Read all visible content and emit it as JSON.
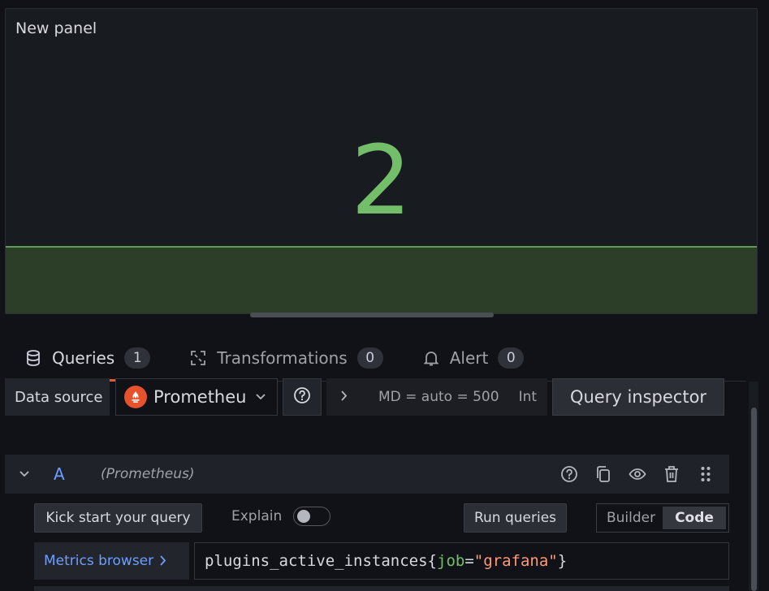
{
  "panel": {
    "title": "New panel",
    "stat_value": "2",
    "value_color": "#73bf69"
  },
  "tabs": [
    {
      "label": "Queries",
      "count": "1",
      "icon": "database-icon",
      "active": true
    },
    {
      "label": "Transformations",
      "count": "0",
      "icon": "transform-icon",
      "active": false
    },
    {
      "label": "Alert",
      "count": "0",
      "icon": "bell-icon",
      "active": false
    }
  ],
  "toolbar": {
    "datasource_label": "Data source",
    "datasource_name": "Prometheu",
    "options_text": "MD = auto = 500",
    "options_trail": "Int",
    "query_inspector_label": "Query inspector"
  },
  "query": {
    "ref_id": "A",
    "datasource": "(Prometheus)",
    "kick_start_label": "Kick start your query",
    "explain_label": "Explain",
    "explain_on": false,
    "run_label": "Run queries",
    "modes": [
      "Builder",
      "Code"
    ],
    "active_mode": "Code",
    "metrics_browser_label": "Metrics browser",
    "expr": {
      "metric": "plugins_active_instances",
      "open": "{",
      "label_key": "job",
      "eq": "=",
      "label_value": "\"grafana\"",
      "close": "}"
    }
  },
  "colors": {
    "accent_tab": "#f05a28",
    "link": "#6e9fff",
    "prometheus": "#e6522c"
  }
}
